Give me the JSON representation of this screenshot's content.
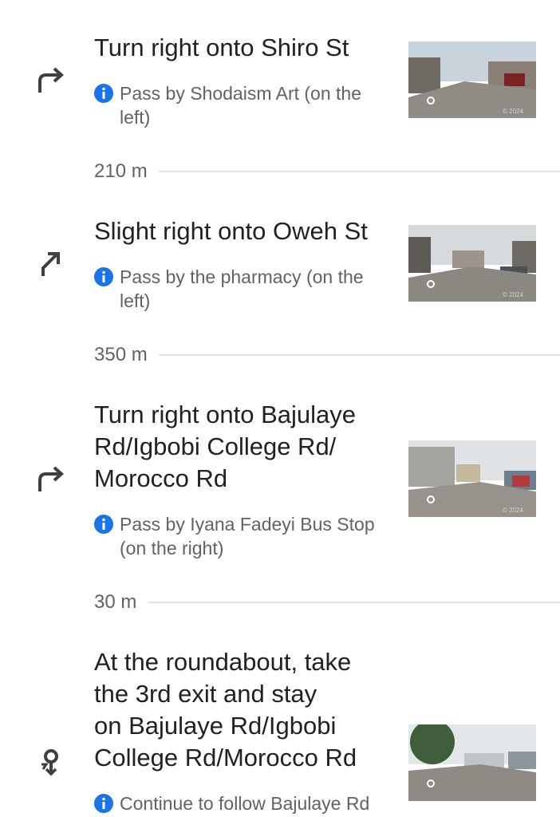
{
  "steps": [
    {
      "instruction": "Turn right onto Shiro St",
      "icon": "turn-right-icon",
      "note": "Pass by Shodaism Art (on the left)"
    },
    {
      "instruction": "Slight right onto Oweh St",
      "icon": "slight-right-icon",
      "note": "Pass by the pharmacy (on the left)"
    },
    {
      "instruction_lines": [
        "Turn right onto Bajulaye",
        "Rd/Igbobi College Rd/",
        "Morocco Rd"
      ],
      "icon": "turn-right-icon",
      "note_lines": [
        "Pass by Iyana Fadeyi Bus Stop",
        "(on the right)"
      ]
    },
    {
      "instruction_lines": [
        "At the roundabout, take",
        "the 3rd exit and stay",
        "on Bajulaye Rd/Igbobi",
        "College Rd/Morocco Rd"
      ],
      "icon": "roundabout-icon",
      "note": "Continue to follow Bajulaye Rd"
    }
  ],
  "distances": [
    "210 m",
    "350 m",
    "30 m"
  ],
  "thumbnail_watermark": "© 2024",
  "colors": {
    "info_blue": "#1a73e8",
    "text_primary": "#202124",
    "text_secondary": "#5f6368",
    "divider": "#e0e3e7"
  }
}
